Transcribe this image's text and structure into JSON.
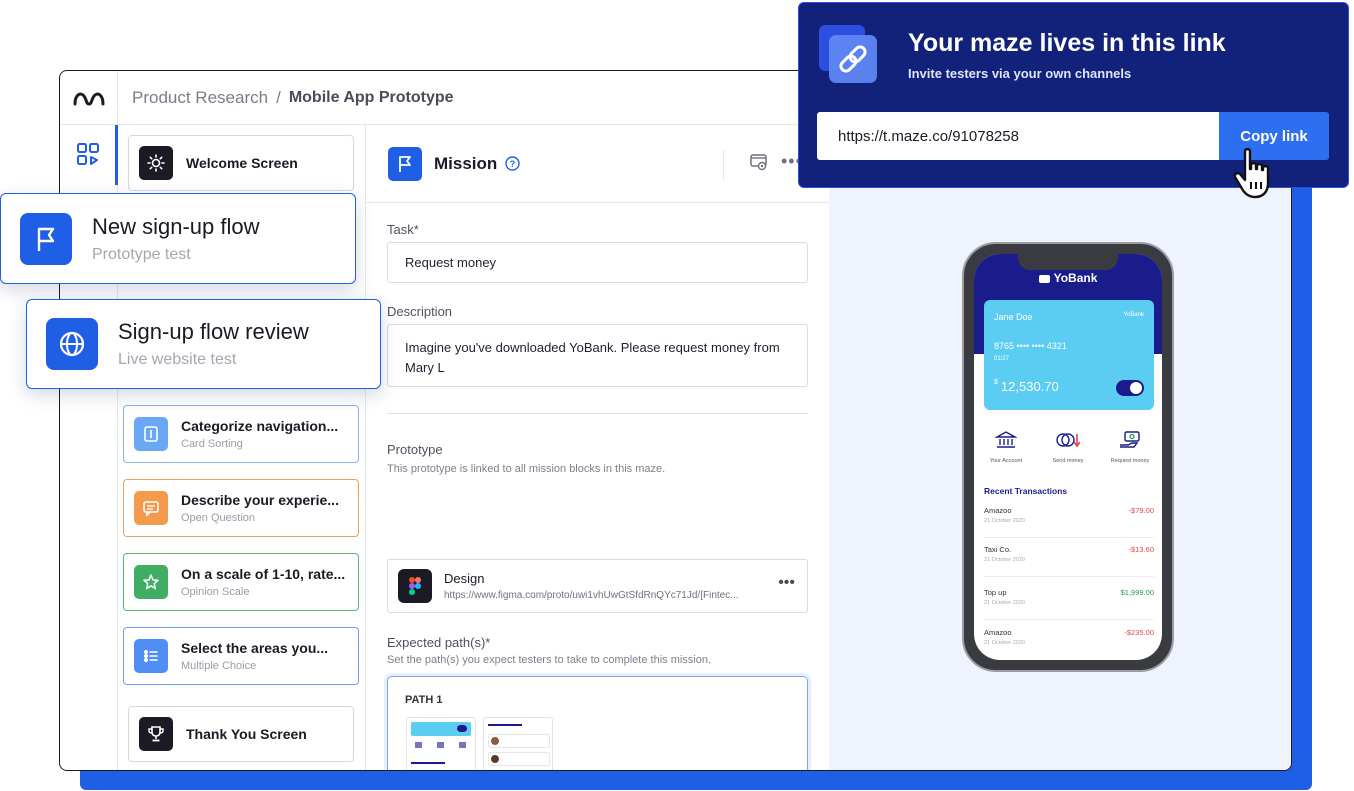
{
  "breadcrumb": {
    "project": "Product Research",
    "separator": "/",
    "maze": "Mobile App Prototype"
  },
  "blocks": [
    {
      "title": "Welcome Screen",
      "subtitle": ""
    },
    {
      "title": "Categorize navigation...",
      "subtitle": "Card Sorting"
    },
    {
      "title": "Describe your experie...",
      "subtitle": "Open Question"
    },
    {
      "title": "On a scale of 1-10, rate...",
      "subtitle": "Opinion Scale"
    },
    {
      "title": "Select the areas you...",
      "subtitle": "Multiple Choice"
    },
    {
      "title": "Thank You Screen",
      "subtitle": ""
    }
  ],
  "floating_cards": [
    {
      "title": "New sign-up flow",
      "subtitle": "Prototype test"
    },
    {
      "title": "Sign-up flow review",
      "subtitle": "Live website test"
    }
  ],
  "editor": {
    "title": "Mission",
    "task_label": "Task*",
    "task_value": "Request money",
    "description_label": "Description",
    "description_value": "Imagine you've downloaded YoBank. Please request money from Mary L",
    "prototype_label": "Prototype",
    "prototype_hint": "This prototype is linked to all mission blocks in this maze.",
    "design_title": "Design",
    "design_url": "https://www.figma.com/proto/uwi1vhUwGtSfdRnQYc71Jd/[Fintec...",
    "expected_label": "Expected path(s)*",
    "expected_hint": "Set the path(s) you expect testers to take to complete this mission.",
    "path_label": "PATH 1"
  },
  "share": {
    "title": "Your maze lives in this link",
    "subtitle": "Invite testers via your own channels",
    "link": "https://t.maze.co/91078258",
    "button": "Copy link"
  },
  "phone": {
    "bank_name": "YoBank",
    "card_name": "Jane Doe",
    "card_brand": "YoBank",
    "card_number": "8765 •••• •••• 4321",
    "card_expiry": "01/27",
    "balance_symbol": "$",
    "balance": "12,530.70",
    "actions": [
      "Your Account",
      "Send money",
      "Request money"
    ],
    "recent_title": "Recent Transactions",
    "transactions": [
      {
        "name": "Amazoo",
        "date": "21 October 2020",
        "amount": "-$79.00"
      },
      {
        "name": "Taxi Co.",
        "date": "21 October 2020",
        "amount": "-$13.60"
      },
      {
        "name": "Top up",
        "date": "21 October 2020",
        "amount": "$1,999.00"
      },
      {
        "name": "Amazoo",
        "date": "21 October 2020",
        "amount": "-$235.00"
      }
    ]
  },
  "colors": {
    "accent": "#1f5fe6",
    "share_bg": "#12217a",
    "negative": "#e0464d",
    "positive": "#1f9d55"
  }
}
